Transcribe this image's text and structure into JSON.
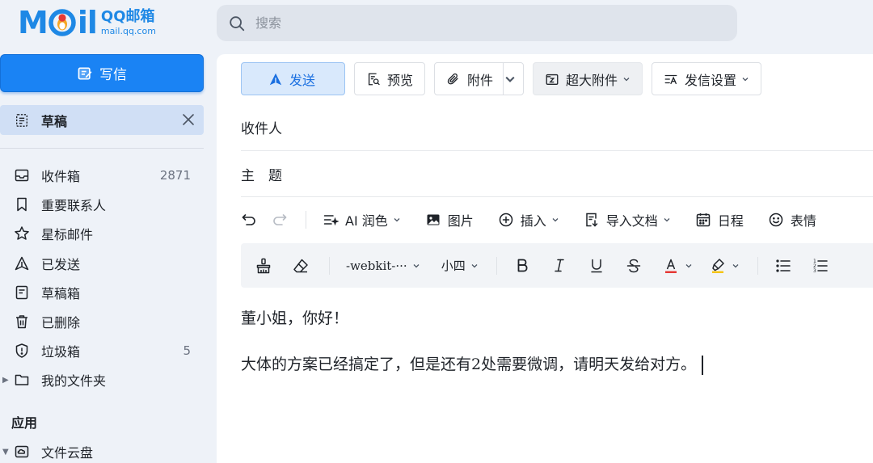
{
  "brand": {
    "mail": "MOil",
    "name": "QQ邮箱",
    "domain": "mail.qq.com"
  },
  "search": {
    "placeholder": "搜索"
  },
  "sidebar": {
    "compose_label": "写信",
    "open_tab_label": "草稿",
    "folders": [
      {
        "label": "收件箱",
        "count": "2871",
        "icon": "inbox-icon"
      },
      {
        "label": "重要联系人",
        "count": "",
        "icon": "bookmark-icon"
      },
      {
        "label": "星标邮件",
        "count": "",
        "icon": "star-icon"
      },
      {
        "label": "已发送",
        "count": "",
        "icon": "sent-icon"
      },
      {
        "label": "草稿箱",
        "count": "",
        "icon": "drafts-icon"
      },
      {
        "label": "已删除",
        "count": "",
        "icon": "trash-icon"
      },
      {
        "label": "垃圾箱",
        "count": "5",
        "icon": "spam-shield-icon"
      },
      {
        "label": "我的文件夹",
        "count": "",
        "icon": "folder-icon"
      }
    ],
    "apps_title": "应用",
    "cloud_label": "文件云盘"
  },
  "toolbar": {
    "send": "发送",
    "preview": "预览",
    "attachment": "附件",
    "large_attachment": "超大附件",
    "send_settings": "发信设置"
  },
  "fields": {
    "to_label": "收件人",
    "subject_label": "主　题",
    "to_value": "",
    "subject_value": ""
  },
  "format_row1": {
    "ai_polish": "AI 润色",
    "image": "图片",
    "insert": "插入",
    "import_doc": "导入文档",
    "schedule": "日程",
    "emoji": "表情"
  },
  "format_row2": {
    "font": "-webkit-···",
    "font_size": "小四",
    "text_color": "#e53935",
    "highlight_color": "#f5c518"
  },
  "body": {
    "greeting": "董小姐，你好！",
    "paragraph": "大体的方案已经搞定了，但是还有2处需要微调，请明天发给对方。"
  },
  "colors": {
    "accent": "#1a83f4",
    "sidebar_bg": "#eef2f8",
    "active_tab_bg": "#d0dff5",
    "send_bg": "#d9e9fc"
  }
}
